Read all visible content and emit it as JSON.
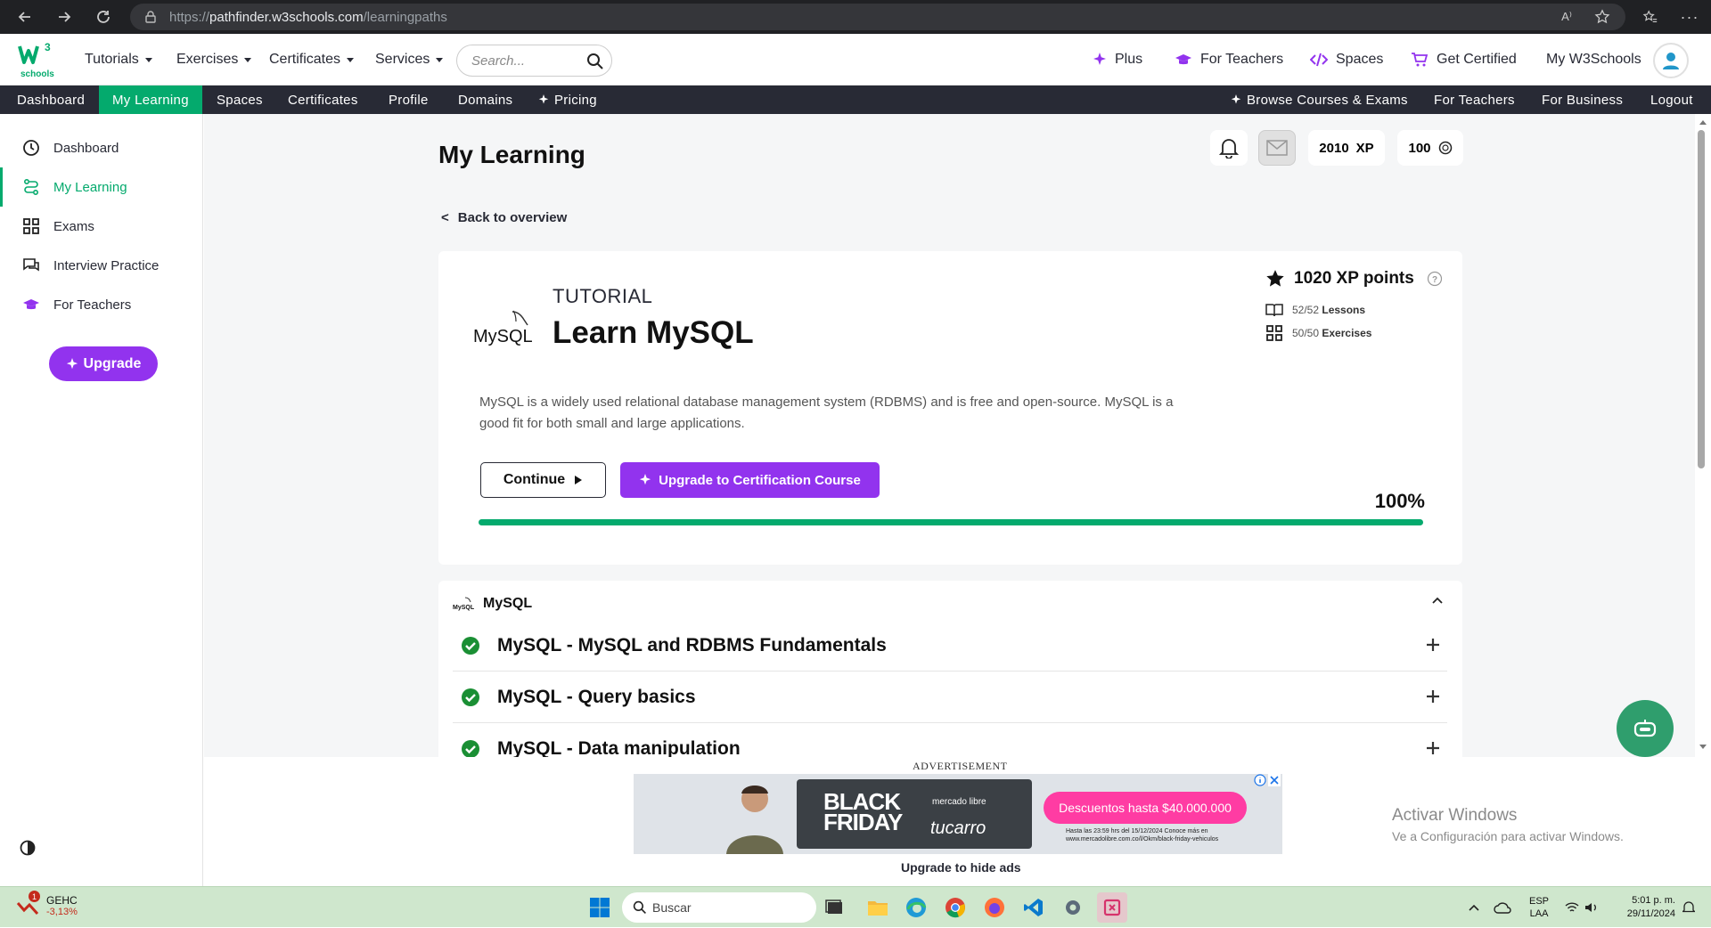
{
  "browser": {
    "url_scheme": "https://",
    "url_host": "pathfinder.w3schools.com",
    "url_path": "/learningpaths"
  },
  "topnav": {
    "logo_text": "schools",
    "logo_sup": "3",
    "menus": [
      "Tutorials",
      "Exercises",
      "Certificates",
      "Services"
    ],
    "search_placeholder": "Search...",
    "right": {
      "plus": "Plus",
      "for_teachers": "For Teachers",
      "spaces": "Spaces",
      "get_certified": "Get Certified",
      "my_w3schools": "My W3Schools"
    }
  },
  "subnav": {
    "left": [
      "Dashboard",
      "My Learning",
      "Spaces",
      "Certificates",
      "Profile",
      "Domains",
      "Pricing"
    ],
    "active": "My Learning",
    "right": [
      "Browse Courses & Exams",
      "For Teachers",
      "For Business",
      "Logout"
    ]
  },
  "sidebar": {
    "items": [
      {
        "label": "Dashboard",
        "icon": "clock-icon"
      },
      {
        "label": "My Learning",
        "icon": "path-icon"
      },
      {
        "label": "Exams",
        "icon": "grid-icon"
      },
      {
        "label": "Interview Practice",
        "icon": "chat-icon"
      },
      {
        "label": "For Teachers",
        "icon": "graduation-cap-icon"
      }
    ],
    "upgrade_label": "Upgrade"
  },
  "header": {
    "title": "My Learning",
    "xp": "2010",
    "xp_unit": "XP",
    "coins": "100"
  },
  "back_link": "Back to overview",
  "course": {
    "type": "TUTORIAL",
    "title": "Learn MySQL",
    "logo_text": "MySQL",
    "xp_points": "1020 XP points",
    "lessons_count": "52/52",
    "lessons_label": "Lessons",
    "exercises_count": "50/50",
    "exercises_label": "Exercises",
    "description": "MySQL is a widely used relational database management system (RDBMS) and is free and open-source. MySQL is a good fit for both small and large applications.",
    "continue_label": "Continue",
    "cert_label": "Upgrade to Certification Course",
    "progress_text": "100%",
    "progress": 1.0
  },
  "syllabus": {
    "section_title": "MySQL",
    "lessons": [
      "MySQL - MySQL and RDBMS Fundamentals",
      "MySQL - Query basics",
      "MySQL - Data manipulation"
    ]
  },
  "ad": {
    "label": "ADVERTISEMENT",
    "headline_1": "BLACK",
    "headline_2": "FRIDAY",
    "brand_1": "mercado libre",
    "brand_2": "tucarro",
    "pill": "Descuentos hasta $40.000.000",
    "fine_print": "Hasta las 23:59 hrs del 15/12/2024 Conoce más en www.mercadolibre.com.co/l/Okm/black-friday-vehiculos",
    "hide_label": "Upgrade to hide ads"
  },
  "watermark": {
    "line1": "Activar Windows",
    "line2": "Ve a Configuración para activar Windows."
  },
  "taskbar": {
    "stock_name": "GEHC",
    "stock_change": "-3,13%",
    "stock_badge": "1",
    "search_label": "Buscar",
    "lang_1": "ESP",
    "lang_2": "LAA",
    "time": "5:01 p. m.",
    "date": "29/11/2024"
  },
  "colors": {
    "green": "#04aa6d",
    "purple": "#9233ee",
    "dark": "#282a35"
  }
}
